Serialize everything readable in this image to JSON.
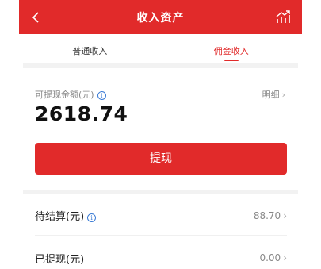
{
  "header": {
    "title": "收入资产",
    "back_icon": "back-arrow-icon",
    "chart_icon": "trend-chart-icon"
  },
  "tabs": [
    {
      "label": "普通收入",
      "active": false
    },
    {
      "label": "佣金收入",
      "active": true
    }
  ],
  "withdrawable": {
    "label": "可提现金额(元)",
    "detail_label": "明细",
    "amount": "2618.74"
  },
  "withdraw_button": {
    "label": "提现"
  },
  "rows": [
    {
      "label": "待结算(元)",
      "value": "88.70",
      "has_info": true
    },
    {
      "label": "已提现(元)",
      "value": "0.00",
      "has_info": false
    }
  ],
  "colors": {
    "accent": "#e12a2a",
    "info": "#3a7bd5"
  }
}
